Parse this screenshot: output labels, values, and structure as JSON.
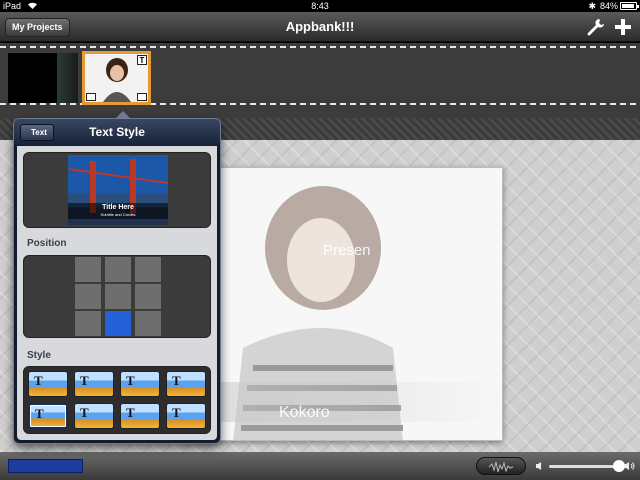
{
  "status_bar": {
    "device": "iPad",
    "time": "8:43",
    "battery": "84%"
  },
  "toolbar": {
    "projects_label": "My Projects",
    "title": "Appbank!!!",
    "icons": [
      "wrench-icon",
      "plus-icon"
    ]
  },
  "timeline": {
    "clips": [
      {
        "name": "clip-dark",
        "selected": false
      },
      {
        "name": "clip-portrait",
        "selected": true,
        "has_title": true,
        "title_badge": "T"
      }
    ]
  },
  "popover": {
    "back_label": "Text",
    "title": "Text Style",
    "sample": {
      "title": "Title Here",
      "subtitle": "Subtitle and Credits"
    },
    "position_label": "Position",
    "position_grid": {
      "rows": 3,
      "cols": 3,
      "selected_row": 2,
      "selected_col": 1
    },
    "style_label": "Style",
    "styles": [
      {
        "glyph": "T",
        "selected": false
      },
      {
        "glyph": "T",
        "selected": false
      },
      {
        "glyph": "T",
        "selected": false
      },
      {
        "glyph": "T",
        "selected": false
      },
      {
        "glyph": "T",
        "selected": true
      },
      {
        "glyph": "T",
        "selected": false
      },
      {
        "glyph": "T",
        "selected": false
      },
      {
        "glyph": "T",
        "selected": false
      }
    ]
  },
  "preview": {
    "overlay_top": "Presen",
    "overlay_bottom": "Kokoro"
  },
  "bottom_bar": {
    "progress": 0.12
  },
  "colors": {
    "accent_selected": "#2460d6",
    "clip_border": "#e59a3a",
    "progress": "#1d3c9c"
  }
}
